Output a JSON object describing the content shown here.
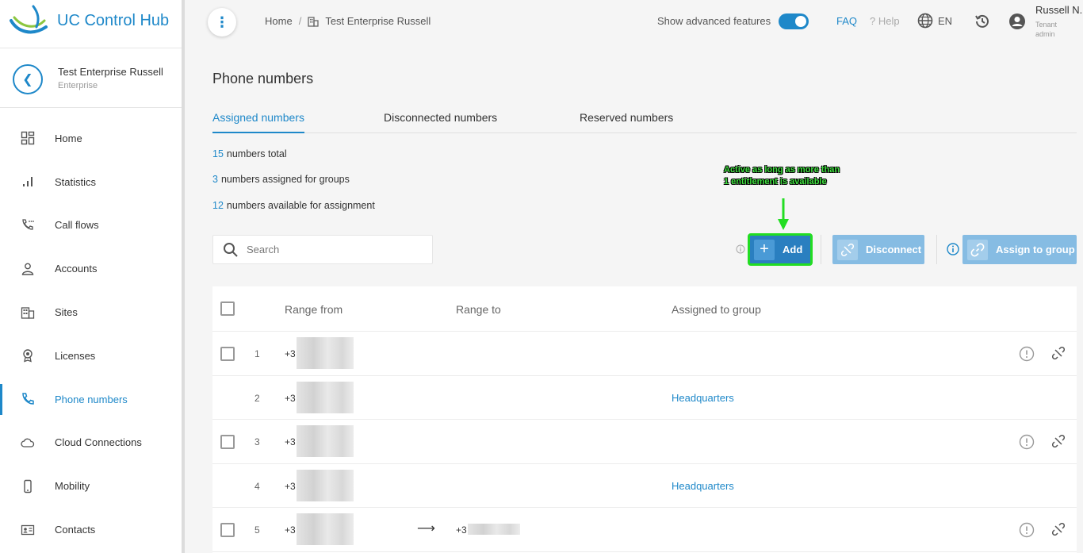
{
  "app": {
    "title": "UC Control Hub"
  },
  "enterprise": {
    "name": "Test Enterprise Russell",
    "type": "Enterprise"
  },
  "nav": [
    {
      "label": "Home",
      "icon": "dashboard-icon"
    },
    {
      "label": "Statistics",
      "icon": "bar-chart-icon"
    },
    {
      "label": "Call flows",
      "icon": "call-flow-icon"
    },
    {
      "label": "Accounts",
      "icon": "person-icon"
    },
    {
      "label": "Sites",
      "icon": "building-icon"
    },
    {
      "label": "Licenses",
      "icon": "license-badge-icon"
    },
    {
      "label": "Phone numbers",
      "icon": "phone-icon",
      "active": true
    },
    {
      "label": "Cloud Connections",
      "icon": "cloud-icon"
    },
    {
      "label": "Mobility",
      "icon": "mobile-icon"
    },
    {
      "label": "Contacts",
      "icon": "contact-card-icon"
    }
  ],
  "header": {
    "breadcrumb": [
      "Home",
      "/",
      "Test Enterprise Russell"
    ],
    "advanced_label": "Show advanced features",
    "advanced_on": true,
    "faq": "FAQ",
    "help": "? Help",
    "lang": "EN",
    "user_name": "Russell N.",
    "user_role": "Tenant admin"
  },
  "page": {
    "title": "Phone numbers",
    "tabs": [
      "Assigned numbers",
      "Disconnected numbers",
      "Reserved numbers"
    ],
    "active_tab": 0
  },
  "stats": [
    {
      "num": "15",
      "text": "numbers total"
    },
    {
      "num": "3",
      "text": "numbers assigned for groups"
    },
    {
      "num": "12",
      "text": "numbers available for assignment"
    }
  ],
  "annotation": "Active as long as more than 1 entitlement is available",
  "search": {
    "placeholder": "Search"
  },
  "actions": {
    "add": "Add",
    "disconnect": "Disconnect",
    "assign": "Assign to group"
  },
  "table": {
    "headers": {
      "from": "Range from",
      "to": "Range to",
      "group": "Assigned to group"
    },
    "rows": [
      {
        "idx": "1",
        "from": "+3",
        "to": "",
        "group": "",
        "checkbox": true,
        "actions": true,
        "arrow": false
      },
      {
        "idx": "2",
        "from": "+3",
        "to": "",
        "group": "Headquarters",
        "checkbox": false,
        "actions": false,
        "arrow": false
      },
      {
        "idx": "3",
        "from": "+3",
        "to": "",
        "group": "",
        "checkbox": true,
        "actions": true,
        "arrow": false
      },
      {
        "idx": "4",
        "from": "+3",
        "to": "",
        "group": "Headquarters",
        "checkbox": false,
        "actions": false,
        "arrow": false
      },
      {
        "idx": "5",
        "from": "+3",
        "to": "+3",
        "group": "",
        "checkbox": true,
        "actions": true,
        "arrow": true
      }
    ]
  },
  "colors": {
    "accent": "#1e88c9",
    "button": "#2a7fc0",
    "button_disabled": "#86bce3",
    "highlight": "#22dd22"
  }
}
